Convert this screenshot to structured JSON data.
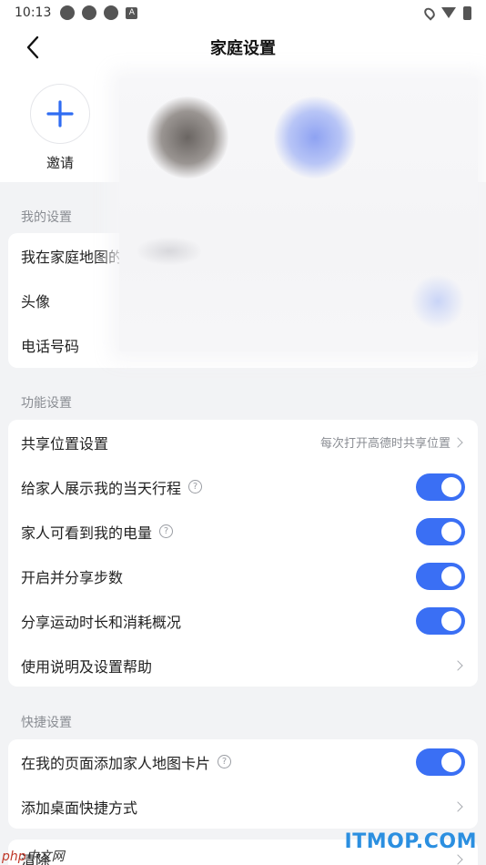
{
  "status_bar": {
    "time": "10:13",
    "indicator": "A"
  },
  "header": {
    "title": "家庭设置"
  },
  "members": {
    "invite_label": "邀请"
  },
  "my_settings": {
    "title": "我的设置",
    "items": [
      {
        "label": "我在家庭地图的"
      },
      {
        "label": "头像"
      },
      {
        "label": "电话号码"
      }
    ]
  },
  "function_settings": {
    "title": "功能设置",
    "items": [
      {
        "label": "共享位置设置",
        "value": "每次打开高德时共享位置"
      },
      {
        "label": "给家人展示我的当天行程",
        "toggle_on": true
      },
      {
        "label": "家人可看到我的电量",
        "toggle_on": true
      },
      {
        "label": "开启并分享步数",
        "toggle_on": true
      },
      {
        "label": "分享运动时长和消耗概况",
        "toggle_on": true
      },
      {
        "label": "使用说明及设置帮助"
      }
    ]
  },
  "quick_settings": {
    "title": "快捷设置",
    "items": [
      {
        "label": "在我的页面添加家人地图卡片",
        "toggle_on": true
      },
      {
        "label": "添加桌面快捷方式"
      }
    ]
  },
  "bottom_partial": {
    "label": "清除"
  },
  "watermarks": {
    "site": "ITMOP.COM",
    "php_en": "php",
    "php_cn": "中文网"
  },
  "colors": {
    "accent": "#3a6ff4",
    "background": "#f2f3f5",
    "card": "#ffffff"
  }
}
